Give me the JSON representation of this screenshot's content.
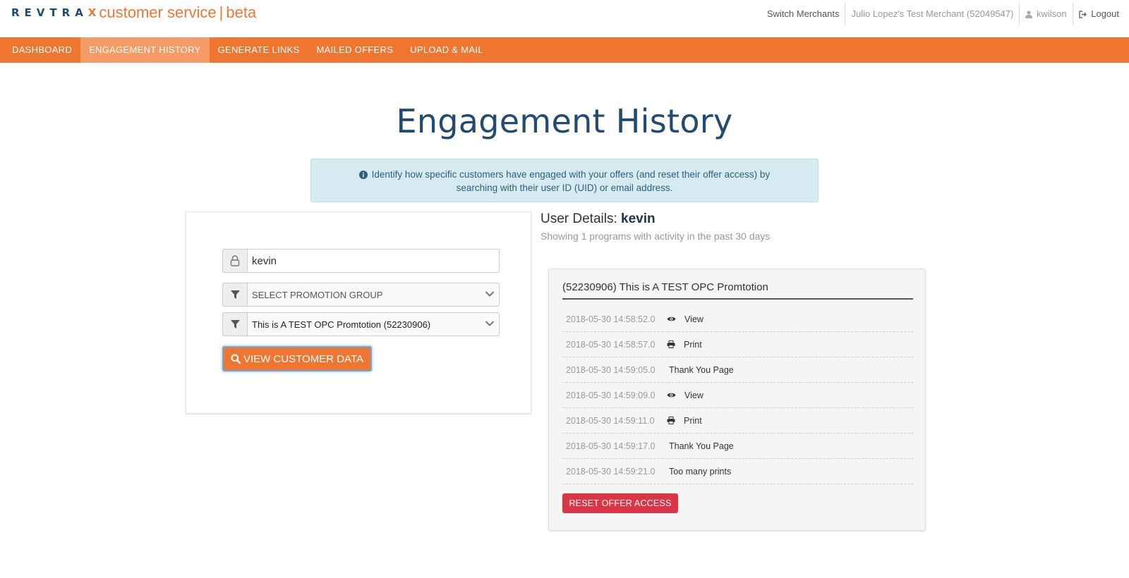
{
  "brand": {
    "rev": "REVTRA",
    "x": "X",
    "product": "customer service",
    "separator": "|",
    "tag": "beta",
    "colors": {
      "navy": "#1e4a78",
      "orange": "#f07531"
    }
  },
  "user_nav": {
    "switch_merchants": "Switch Merchants",
    "merchant": "Julio Lopez's Test Merchant (52049547)",
    "username": "kwilson",
    "logout": "Logout"
  },
  "nav": {
    "items": [
      {
        "label": "DASHBOARD"
      },
      {
        "label": "ENGAGEMENT HISTORY",
        "active": true
      },
      {
        "label": "GENERATE LINKS"
      },
      {
        "label": "MAILED OFFERS"
      },
      {
        "label": "UPLOAD & MAIL"
      }
    ],
    "active_color": "#f59c66"
  },
  "page": {
    "title": "Engagement History",
    "info_line1": "Identify how specific customers have engaged with your offers (and reset their offer access) by",
    "info_line2": "searching with their user ID (UID) or email address."
  },
  "search": {
    "user_value": "kevin",
    "promotion_group": "SELECT PROMOTION GROUP",
    "promotion": "This is A TEST OPC Promtotion (52230906)",
    "button_label": "VIEW CUSTOMER DATA"
  },
  "user_details": {
    "label": "User Details:",
    "user": "kevin",
    "summary": "Showing 1 programs with activity in the past 30 days"
  },
  "program": {
    "title": "(52230906) This is A TEST OPC Promtotion",
    "activities": [
      {
        "time": "2018-05-30 14:58:52.0",
        "action": "View",
        "icon": "eye-icon"
      },
      {
        "time": "2018-05-30 14:58:57.0",
        "action": "Print",
        "icon": "printer-icon"
      },
      {
        "time": "2018-05-30 14:59:05.0",
        "action": "Thank You Page",
        "icon": ""
      },
      {
        "time": "2018-05-30 14:59:09.0",
        "action": "View",
        "icon": "eye-icon"
      },
      {
        "time": "2018-05-30 14:59:11.0",
        "action": "Print",
        "icon": "printer-icon"
      },
      {
        "time": "2018-05-30 14:59:17.0",
        "action": "Thank You Page",
        "icon": ""
      },
      {
        "time": "2018-05-30 14:59:21.0",
        "action": "Too many prints",
        "icon": ""
      }
    ],
    "reset_label": "RESET OFFER ACCESS",
    "reset_color": "#dc3545"
  }
}
